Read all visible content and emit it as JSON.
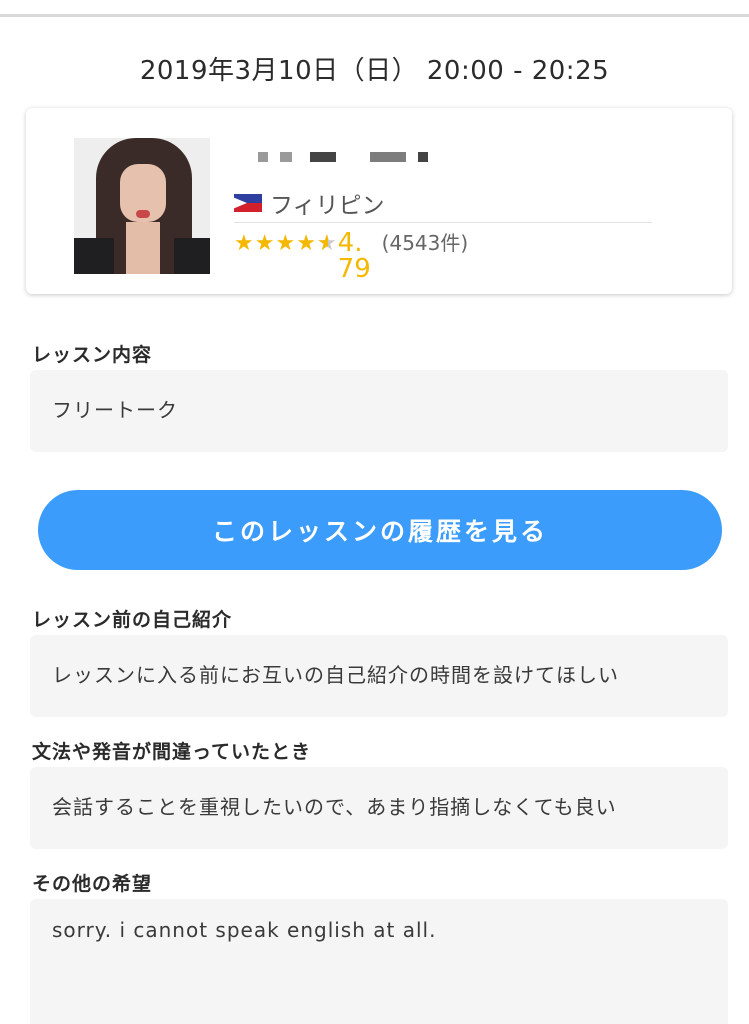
{
  "lesson": {
    "datetime": "2019年3月10日（日） 20:00 - 20:25"
  },
  "tutor": {
    "country": "フィリピン",
    "flag_icon": "philippines-flag-icon",
    "rating": {
      "score": "4.79",
      "stars": 4.79,
      "review_count": "(4543件)",
      "star_color": "#f5b800"
    }
  },
  "sections": {
    "lesson_content": {
      "label": "レッスン内容",
      "value": "フリートーク"
    },
    "history_button": {
      "label": "このレッスンの履歴を見る",
      "color": "#3b9cfb"
    },
    "self_intro": {
      "label": "レッスン前の自己紹介",
      "value": "レッスンに入る前にお互いの自己紹介の時間を設けてほしい"
    },
    "corrections": {
      "label": "文法や発音が間違っていたとき",
      "value": "会話することを重視したいので、あまり指摘しなくても良い"
    },
    "other_requests": {
      "label": "その他の希望",
      "value": "sorry. i cannot speak english at all."
    }
  }
}
